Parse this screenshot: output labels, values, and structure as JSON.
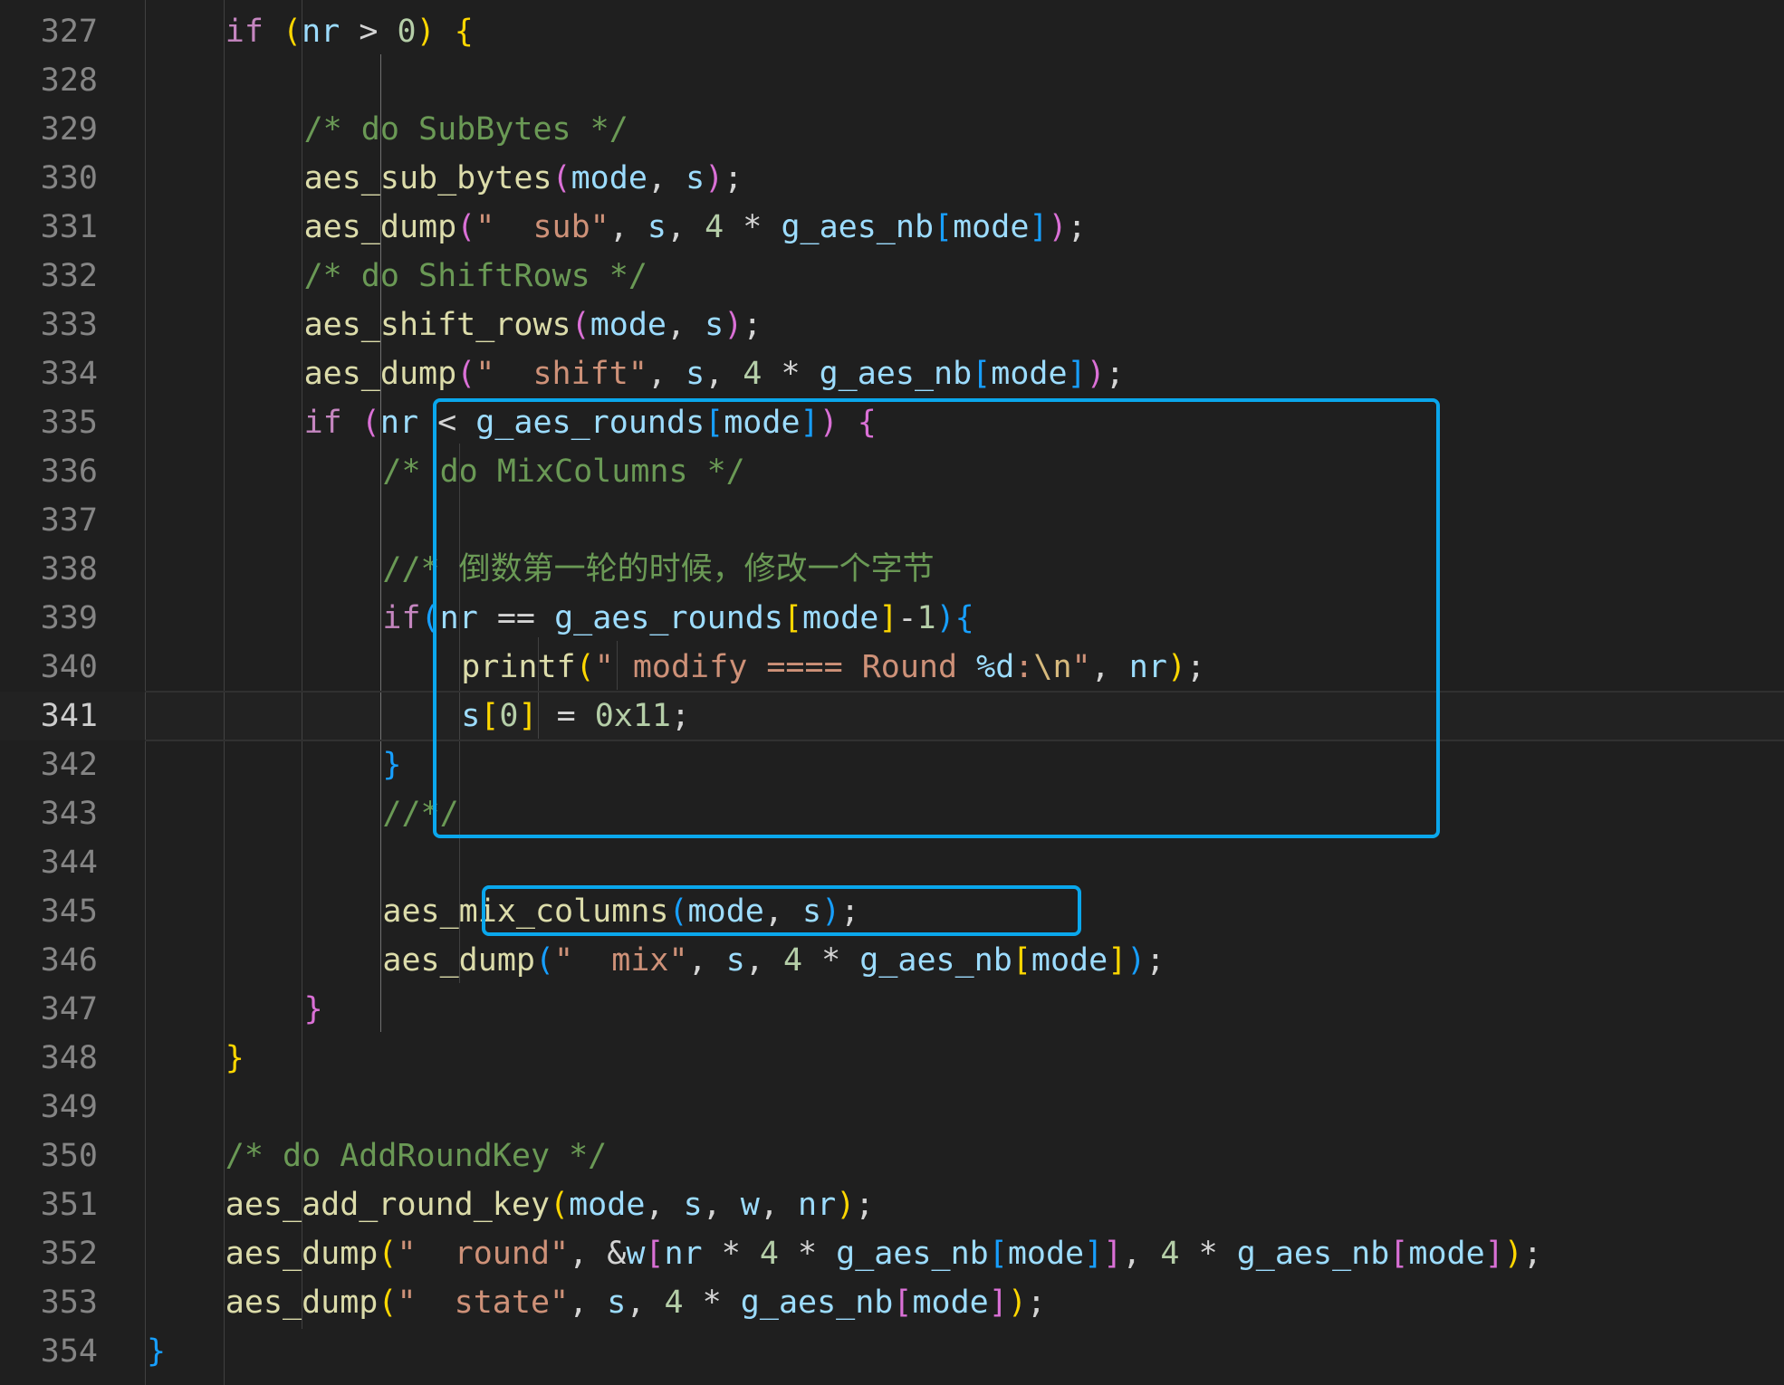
{
  "editor": {
    "language": "c",
    "current_line": 341,
    "highlight_color": "#0aa7ec",
    "lines": [
      {
        "n": 327,
        "indent": 2,
        "tokens": [
          [
            "kw",
            "if"
          ],
          [
            "op",
            " "
          ],
          [
            "b1",
            "("
          ],
          [
            "var",
            "nr"
          ],
          [
            "op",
            " > "
          ],
          [
            "num",
            "0"
          ],
          [
            "b1",
            ")"
          ],
          [
            "op",
            " "
          ],
          [
            "b1",
            "{"
          ]
        ]
      },
      {
        "n": 328,
        "indent": 0,
        "tokens": []
      },
      {
        "n": 329,
        "indent": 3,
        "tokens": [
          [
            "cmt",
            "/* do SubBytes */"
          ]
        ]
      },
      {
        "n": 330,
        "indent": 3,
        "tokens": [
          [
            "fn",
            "aes_sub_bytes"
          ],
          [
            "b2",
            "("
          ],
          [
            "var",
            "mode"
          ],
          [
            "op",
            ", "
          ],
          [
            "var",
            "s"
          ],
          [
            "b2",
            ")"
          ],
          [
            "op",
            ";"
          ]
        ]
      },
      {
        "n": 331,
        "indent": 3,
        "tokens": [
          [
            "fn",
            "aes_dump"
          ],
          [
            "b2",
            "("
          ],
          [
            "str",
            "\"  sub\""
          ],
          [
            "op",
            ", "
          ],
          [
            "var",
            "s"
          ],
          [
            "op",
            ", "
          ],
          [
            "num",
            "4"
          ],
          [
            "op",
            " * "
          ],
          [
            "var",
            "g_aes_nb"
          ],
          [
            "b3",
            "["
          ],
          [
            "var",
            "mode"
          ],
          [
            "b3",
            "]"
          ],
          [
            "b2",
            ")"
          ],
          [
            "op",
            ";"
          ]
        ]
      },
      {
        "n": 332,
        "indent": 3,
        "tokens": [
          [
            "cmt",
            "/* do ShiftRows */"
          ]
        ]
      },
      {
        "n": 333,
        "indent": 3,
        "tokens": [
          [
            "fn",
            "aes_shift_rows"
          ],
          [
            "b2",
            "("
          ],
          [
            "var",
            "mode"
          ],
          [
            "op",
            ", "
          ],
          [
            "var",
            "s"
          ],
          [
            "b2",
            ")"
          ],
          [
            "op",
            ";"
          ]
        ]
      },
      {
        "n": 334,
        "indent": 3,
        "tokens": [
          [
            "fn",
            "aes_dump"
          ],
          [
            "b2",
            "("
          ],
          [
            "str",
            "\"  shift\""
          ],
          [
            "op",
            ", "
          ],
          [
            "var",
            "s"
          ],
          [
            "op",
            ", "
          ],
          [
            "num",
            "4"
          ],
          [
            "op",
            " * "
          ],
          [
            "var",
            "g_aes_nb"
          ],
          [
            "b3",
            "["
          ],
          [
            "var",
            "mode"
          ],
          [
            "b3",
            "]"
          ],
          [
            "b2",
            ")"
          ],
          [
            "op",
            ";"
          ]
        ]
      },
      {
        "n": 335,
        "indent": 3,
        "tokens": [
          [
            "kw",
            "if"
          ],
          [
            "op",
            " "
          ],
          [
            "b2",
            "("
          ],
          [
            "var",
            "nr"
          ],
          [
            "op",
            " < "
          ],
          [
            "var",
            "g_aes_rounds"
          ],
          [
            "b3",
            "["
          ],
          [
            "var",
            "mode"
          ],
          [
            "b3",
            "]"
          ],
          [
            "b2",
            ")"
          ],
          [
            "op",
            " "
          ],
          [
            "b2",
            "{"
          ]
        ]
      },
      {
        "n": 336,
        "indent": 4,
        "tokens": [
          [
            "cmt",
            "/* do MixColumns */"
          ]
        ]
      },
      {
        "n": 337,
        "indent": 0,
        "tokens": []
      },
      {
        "n": 338,
        "indent": 4,
        "tokens": [
          [
            "cmt",
            "//* 倒数第一轮的时候，修改一个字节"
          ]
        ]
      },
      {
        "n": 339,
        "indent": 4,
        "tokens": [
          [
            "kw",
            "if"
          ],
          [
            "b3",
            "("
          ],
          [
            "var",
            "nr"
          ],
          [
            "op",
            " == "
          ],
          [
            "var",
            "g_aes_rounds"
          ],
          [
            "b1",
            "["
          ],
          [
            "var",
            "mode"
          ],
          [
            "b1",
            "]"
          ],
          [
            "op",
            "-"
          ],
          [
            "num",
            "1"
          ],
          [
            "b3",
            ")"
          ],
          [
            "b3",
            "{"
          ]
        ]
      },
      {
        "n": 340,
        "indent": 5,
        "tokens": [
          [
            "fn",
            "printf"
          ],
          [
            "b1",
            "("
          ],
          [
            "str",
            "\" modify ==== Round "
          ],
          [
            "var",
            "%d"
          ],
          [
            "str",
            ":"
          ],
          [
            "esc",
            "\\n"
          ],
          [
            "str",
            "\""
          ],
          [
            "op",
            ", "
          ],
          [
            "var",
            "nr"
          ],
          [
            "b1",
            ")"
          ],
          [
            "op",
            ";"
          ]
        ]
      },
      {
        "n": 341,
        "indent": 5,
        "tokens": [
          [
            "var",
            "s"
          ],
          [
            "b1",
            "["
          ],
          [
            "num",
            "0"
          ],
          [
            "b1",
            "]"
          ],
          [
            "op",
            " = "
          ],
          [
            "num",
            "0x11"
          ],
          [
            "op",
            ";"
          ]
        ]
      },
      {
        "n": 342,
        "indent": 4,
        "tokens": [
          [
            "b3",
            "}"
          ]
        ]
      },
      {
        "n": 343,
        "indent": 4,
        "tokens": [
          [
            "cmt",
            "//*/"
          ]
        ]
      },
      {
        "n": 344,
        "indent": 0,
        "tokens": []
      },
      {
        "n": 345,
        "indent": 4,
        "tokens": [
          [
            "fn",
            "aes_mix_columns"
          ],
          [
            "b3",
            "("
          ],
          [
            "var",
            "mode"
          ],
          [
            "op",
            ", "
          ],
          [
            "var",
            "s"
          ],
          [
            "b3",
            ")"
          ],
          [
            "op",
            ";"
          ]
        ]
      },
      {
        "n": 346,
        "indent": 4,
        "tokens": [
          [
            "fn",
            "aes_dump"
          ],
          [
            "b3",
            "("
          ],
          [
            "str",
            "\"  mix\""
          ],
          [
            "op",
            ", "
          ],
          [
            "var",
            "s"
          ],
          [
            "op",
            ", "
          ],
          [
            "num",
            "4"
          ],
          [
            "op",
            " * "
          ],
          [
            "var",
            "g_aes_nb"
          ],
          [
            "b1",
            "["
          ],
          [
            "var",
            "mode"
          ],
          [
            "b1",
            "]"
          ],
          [
            "b3",
            ")"
          ],
          [
            "op",
            ";"
          ]
        ]
      },
      {
        "n": 347,
        "indent": 3,
        "tokens": [
          [
            "b2",
            "}"
          ]
        ]
      },
      {
        "n": 348,
        "indent": 2,
        "tokens": [
          [
            "b1",
            "}"
          ]
        ]
      },
      {
        "n": 349,
        "indent": 0,
        "tokens": []
      },
      {
        "n": 350,
        "indent": 2,
        "tokens": [
          [
            "cmt",
            "/* do AddRoundKey */"
          ]
        ]
      },
      {
        "n": 351,
        "indent": 2,
        "tokens": [
          [
            "fn",
            "aes_add_round_key"
          ],
          [
            "b1",
            "("
          ],
          [
            "var",
            "mode"
          ],
          [
            "op",
            ", "
          ],
          [
            "var",
            "s"
          ],
          [
            "op",
            ", "
          ],
          [
            "var",
            "w"
          ],
          [
            "op",
            ", "
          ],
          [
            "var",
            "nr"
          ],
          [
            "b1",
            ")"
          ],
          [
            "op",
            ";"
          ]
        ]
      },
      {
        "n": 352,
        "indent": 2,
        "tokens": [
          [
            "fn",
            "aes_dump"
          ],
          [
            "b1",
            "("
          ],
          [
            "str",
            "\"  round\""
          ],
          [
            "op",
            ", &"
          ],
          [
            "var",
            "w"
          ],
          [
            "b2",
            "["
          ],
          [
            "var",
            "nr"
          ],
          [
            "op",
            " * "
          ],
          [
            "num",
            "4"
          ],
          [
            "op",
            " * "
          ],
          [
            "var",
            "g_aes_nb"
          ],
          [
            "b3",
            "["
          ],
          [
            "var",
            "mode"
          ],
          [
            "b3",
            "]"
          ],
          [
            "b2",
            "]"
          ],
          [
            "op",
            ", "
          ],
          [
            "num",
            "4"
          ],
          [
            "op",
            " * "
          ],
          [
            "var",
            "g_aes_nb"
          ],
          [
            "b2",
            "["
          ],
          [
            "var",
            "mode"
          ],
          [
            "b2",
            "]"
          ],
          [
            "b1",
            ")"
          ],
          [
            "op",
            ";"
          ]
        ]
      },
      {
        "n": 353,
        "indent": 2,
        "tokens": [
          [
            "fn",
            "aes_dump"
          ],
          [
            "b1",
            "("
          ],
          [
            "str",
            "\"  state\""
          ],
          [
            "op",
            ", "
          ],
          [
            "var",
            "s"
          ],
          [
            "op",
            ", "
          ],
          [
            "num",
            "4"
          ],
          [
            "op",
            " * "
          ],
          [
            "var",
            "g_aes_nb"
          ],
          [
            "b2",
            "["
          ],
          [
            "var",
            "mode"
          ],
          [
            "b2",
            "]"
          ],
          [
            "b1",
            ")"
          ],
          [
            "op",
            ";"
          ]
        ]
      },
      {
        "n": 354,
        "indent": 1,
        "tokens": [
          [
            "b3",
            "}"
          ]
        ]
      }
    ]
  }
}
